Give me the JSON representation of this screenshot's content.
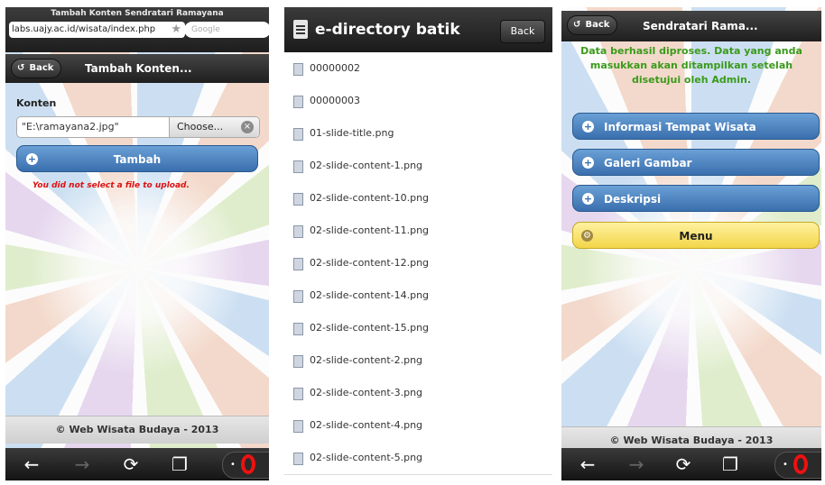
{
  "phone1": {
    "page_title": "Tambah Konten Sendratari Ramayana",
    "url": "labs.uajy.ac.id/wisata/index.php",
    "search_placeholder": "Google",
    "back_label": "Back",
    "header_title": "Tambah Konten...",
    "field_label": "Konten",
    "file_value": "\"E:\\ramayana2.jpg\"",
    "choose_label": "Choose...",
    "submit_label": "Tambah",
    "error_text": "You did not select a file to upload.",
    "footer": "© Web Wisata Budaya - 2013"
  },
  "phone2": {
    "title": "e-directory batik",
    "back_label": "Back",
    "files": [
      "00000002",
      "00000003",
      "01-slide-title.png",
      "02-slide-content-1.png",
      "02-slide-content-10.png",
      "02-slide-content-11.png",
      "02-slide-content-12.png",
      "02-slide-content-14.png",
      "02-slide-content-15.png",
      "02-slide-content-2.png",
      "02-slide-content-3.png",
      "02-slide-content-4.png",
      "02-slide-content-5.png"
    ]
  },
  "phone3": {
    "back_label": "Back",
    "header_title": "Sendratari Rama...",
    "success_lines": [
      "Data berhasil diproses. Data yang anda",
      "masukkan akan ditampilkan setelah",
      "disetujui oleh Admin."
    ],
    "buttons": [
      "Informasi Tempat Wisata",
      "Galeri Gambar",
      "Deskripsi"
    ],
    "menu_label": "Menu",
    "footer": "© Web Wisata Budaya - 2013"
  },
  "colors": {
    "button_blue": "#4a80c0",
    "success_green": "#3a9a1a",
    "error_red": "#dd1111",
    "menu_yellow": "#f5dc5a",
    "opera_red": "#e11111"
  },
  "icons": [
    "back-arrow-icon",
    "star-icon",
    "plus-icon",
    "clear-icon",
    "document-icon",
    "file-icon",
    "gear-icon",
    "left-arrow-icon",
    "right-arrow-icon",
    "reload-icon",
    "tabs-icon",
    "opera-icon"
  ]
}
